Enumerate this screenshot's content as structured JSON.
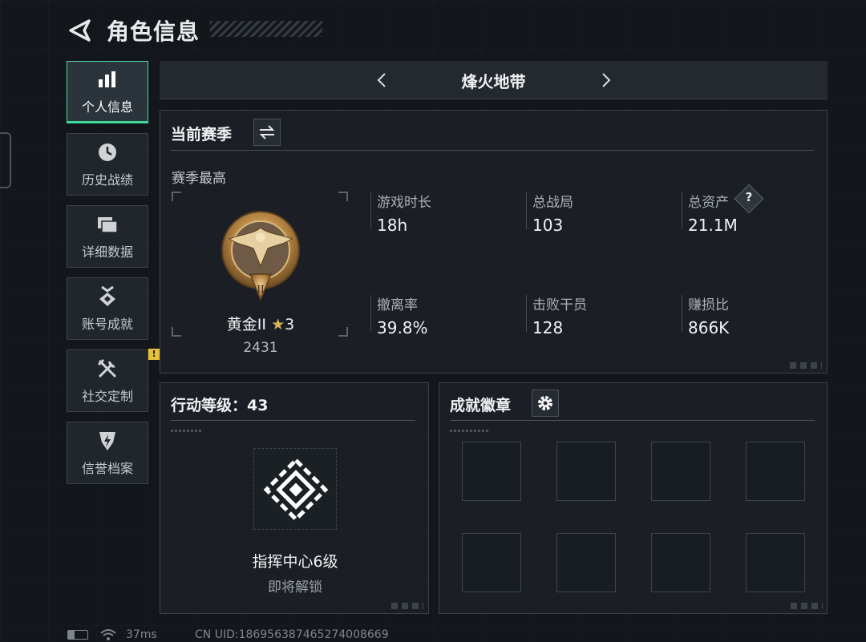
{
  "header": {
    "title": "角色信息"
  },
  "sidebar": {
    "items": [
      {
        "label": "个人信息",
        "icon": "bar-chart-icon",
        "active": true
      },
      {
        "label": "历史战绩",
        "icon": "clock-icon"
      },
      {
        "label": "详细数据",
        "icon": "folder-icon"
      },
      {
        "label": "账号成就",
        "icon": "medal-icon"
      },
      {
        "label": "社交定制",
        "icon": "tools-icon",
        "badge": "!"
      },
      {
        "label": "信誉档案",
        "icon": "shield-icon"
      }
    ]
  },
  "mode": {
    "title": "烽火地带"
  },
  "season": {
    "header": "当前赛季",
    "best_label": "赛季最高",
    "rank_name": "黄金II",
    "rank_stars": "3",
    "rank_points": "2431",
    "stats": [
      {
        "label": "游戏时长",
        "value": "18h"
      },
      {
        "label": "总战局",
        "value": "103"
      },
      {
        "label": "总资产",
        "value": "21.1M",
        "help": "?"
      },
      {
        "label": "撤离率",
        "value": "39.8%"
      },
      {
        "label": "击败干员",
        "value": "128"
      },
      {
        "label": "赚损比",
        "value": "866K"
      }
    ]
  },
  "action_level": {
    "header": "行动等级：43",
    "unlock_title": "指挥中心6级",
    "unlock_sub": "即将解锁"
  },
  "achievements": {
    "header": "成就徽章"
  },
  "footer": {
    "ping": "37ms",
    "uid": "CN UID:1869563874652740086​69"
  },
  "colors": {
    "accent": "#3ddc9a",
    "badge": "#e8c13a",
    "gold": "#c49a55"
  }
}
